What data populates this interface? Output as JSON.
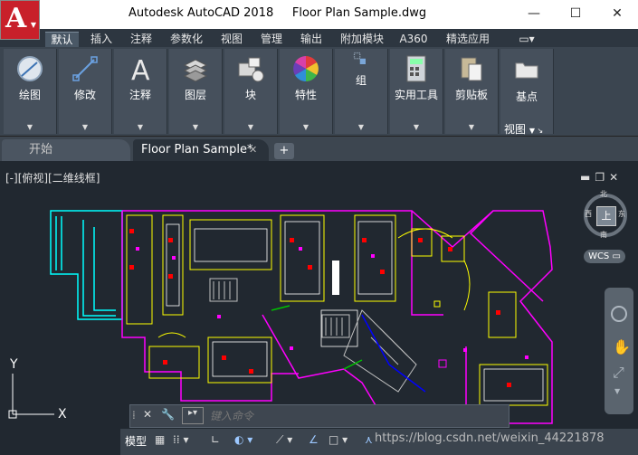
{
  "window": {
    "title": "Autodesk AutoCAD 2018     Floor Plan Sample.dwg",
    "minimize_icon": "—",
    "maximize_icon": "☐",
    "close_icon": "✕"
  },
  "ribbon_tabs": [
    "默认",
    "插入",
    "注释",
    "参数化",
    "视图",
    "管理",
    "输出",
    "附加模块",
    "A360",
    "精选应用"
  ],
  "ribbon_panels": [
    "绘图",
    "修改",
    "注释",
    "图层",
    "块",
    "特性",
    "组",
    "实用工具",
    "剪贴板",
    "基点"
  ],
  "view_panel_label": "视图",
  "file_tabs": {
    "start": "开始",
    "drawing": "Floor Plan Sample*",
    "close": "✕",
    "add": "+"
  },
  "viewport": {
    "label": "[-][俯视][二维线框]",
    "viewcube_top": "上",
    "north": "北",
    "south": "南",
    "east": "东",
    "west": "西",
    "wcs": "WCS ▭",
    "axis_y": "Y",
    "axis_x": "X"
  },
  "command_line": {
    "placeholder": "键入命令"
  },
  "status_bar": {
    "model": "模型"
  },
  "watermark": "https://blog.csdn.net/weixin_44221878",
  "colors": {
    "accent_red": "#c8202a",
    "magenta": "#ff00ff",
    "yellow": "#ffff00",
    "cyan": "#00ffff",
    "white": "#ffffff",
    "green": "#00c000",
    "blue": "#0000ff",
    "red": "#ff0000"
  }
}
